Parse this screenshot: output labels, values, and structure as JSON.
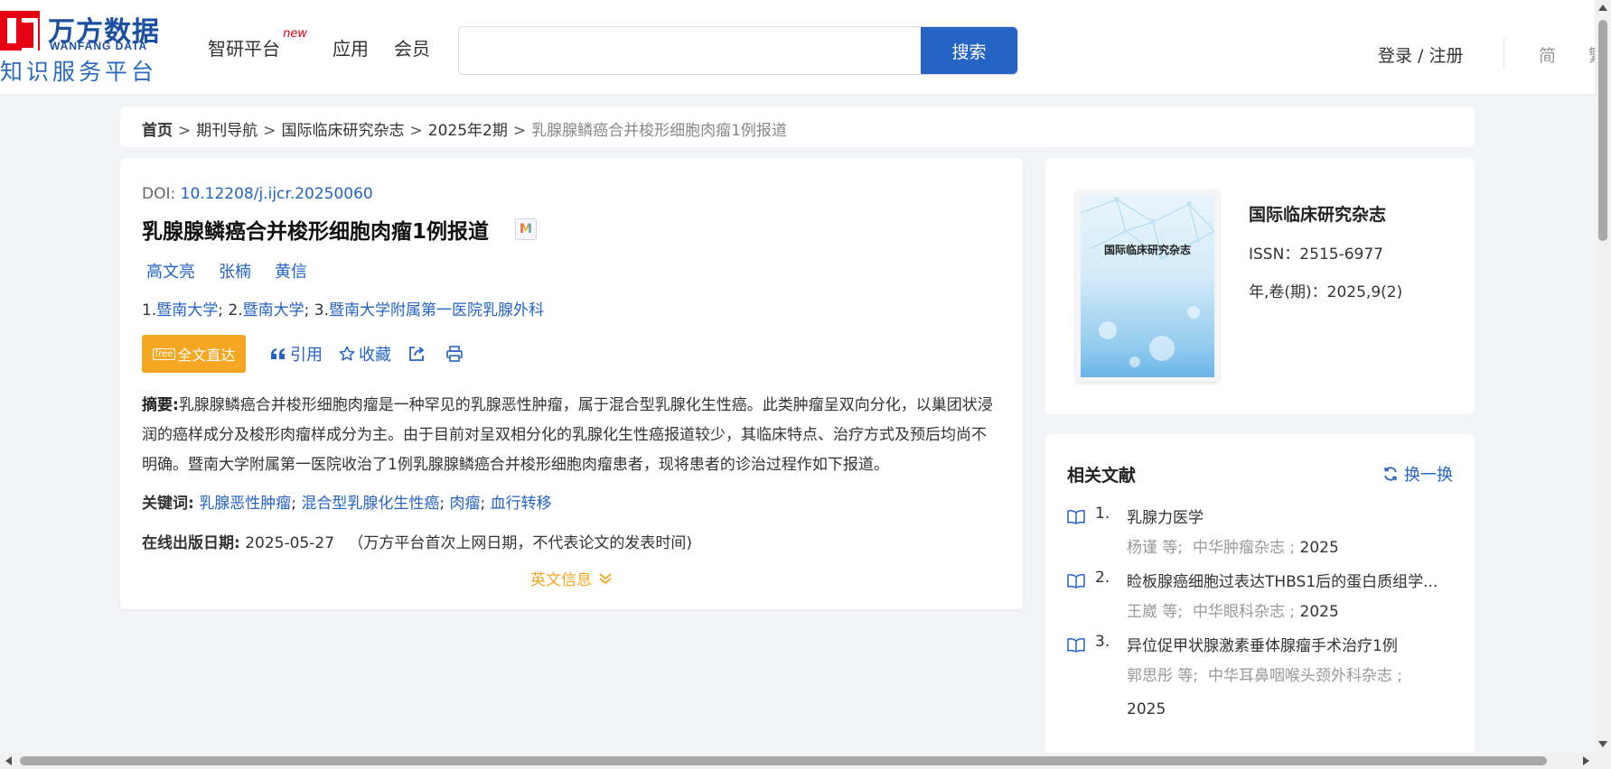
{
  "header": {
    "logo_cn": "万方数据",
    "logo_en": "WANFANG DATA",
    "logo_sub": "知识服务平台",
    "nav": [
      {
        "label": "智研平台",
        "badge": "new"
      },
      {
        "label": "应用"
      },
      {
        "label": "会员"
      }
    ],
    "search_value": "",
    "search_button": "搜索",
    "login": "登录 / 注册",
    "lang_simplified": "简",
    "lang_traditional": "繁"
  },
  "breadcrumb": {
    "items": [
      "首页",
      "期刊导航",
      "国际临床研究杂志",
      "2025年2期"
    ],
    "current": "乳腺腺鳞癌合并梭形细胞肉瘤1例报道",
    "separator": ">"
  },
  "article": {
    "doi_label": "DOI: ",
    "doi": "10.12208/j.ijcr.20250060",
    "title": "乳腺腺鳞癌合并梭形细胞肉瘤1例报道",
    "title_badge": "M",
    "authors": [
      "高文亮",
      "张楠",
      "黄信"
    ],
    "affiliations": [
      {
        "prefix": "1.",
        "name": "暨南大学"
      },
      {
        "prefix": "2.",
        "name": "暨南大学"
      },
      {
        "prefix": "3.",
        "name": "暨南大学附属第一医院乳腺外科"
      }
    ],
    "fulltext_button": "全文直达",
    "fulltext_tag": "free",
    "actions": {
      "cite": "引用",
      "favorite": "收藏"
    },
    "abstract_label": "摘要:",
    "abstract": "乳腺腺鳞癌合并梭形细胞肉瘤是一种罕见的乳腺恶性肿瘤，属于混合型乳腺化生性癌。此类肿瘤呈双向分化，以巢团状浸润的癌样成分及梭形肉瘤样成分为主。由于目前对呈双相分化的乳腺化生性癌报道较少，其临床特点、治疗方式及预后均尚不明确。暨南大学附属第一医院收治了1例乳腺腺鳞癌合并梭形细胞肉瘤患者，现将患者的诊治过程作如下报道。",
    "keywords_label": "关键词:",
    "keywords": [
      "乳腺恶性肿瘤",
      "混合型乳腺化生性癌",
      "肉瘤",
      "血行转移"
    ],
    "pubdate_label": "在线出版日期:",
    "pubdate": "2025-05-27",
    "pubdate_note": "（万方平台首次上网日期，不代表论文的发表时间)",
    "english_info": "英文信息"
  },
  "journal": {
    "cover_title": "国际临床研究杂志",
    "name": "国际临床研究杂志",
    "issn": "ISSN：2515-6977",
    "volume": "年,卷(期)：2025,9(2)"
  },
  "related": {
    "title": "相关文献",
    "refresh": "换一换",
    "items": [
      {
        "num": "1.",
        "title": "乳腺力医学",
        "authors": "杨谨  等;",
        "journal": "中华肿瘤杂志 ;",
        "year": "2025"
      },
      {
        "num": "2.",
        "title": "睑板腺癌细胞过表达THBS1后的蛋白质组学...",
        "authors": "王崴  等;",
        "journal": "中华眼科杂志 ;",
        "year": "2025"
      },
      {
        "num": "3.",
        "title": "异位促甲状腺激素垂体腺瘤手术治疗1例",
        "authors": "郭思彤  等;",
        "journal": "中华耳鼻咽喉头颈外科杂志 ;",
        "year": "2025"
      }
    ]
  },
  "colors": {
    "accent": "#2563c4",
    "fulltext": "#f5a623",
    "logo_red": "#e60012",
    "logo_blue": "#1b4fa0"
  }
}
